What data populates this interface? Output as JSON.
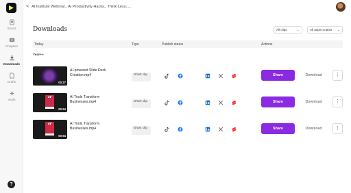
{
  "header": {
    "back_glyph": "<",
    "breadcrumb": "AI Institute Webinar_ AI Productivity Hacks_ Think Less, ..."
  },
  "sidebar": {
    "items": [
      {
        "label": "Shorts",
        "icon": "shorts-icon"
      },
      {
        "label": "Chapters",
        "icon": "chapters-icon"
      },
      {
        "label": "Downloads",
        "icon": "download-icon",
        "active": true
      },
      {
        "label": "Drafts",
        "icon": "drafts-icon"
      },
      {
        "label": "Vidds",
        "icon": "vidds-icon"
      }
    ],
    "help_glyph": "?"
  },
  "main": {
    "title": "Downloads",
    "filters": {
      "clips": "All clips",
      "aspect": "All aspect ratios"
    },
    "columns": {
      "today": "Today",
      "type": "Type",
      "publish": "Publish status",
      "actions": "Actions"
    },
    "group": "Year++",
    "rows": [
      {
        "file": "AI-powered Slide Deck Creation.mp4",
        "duration": "00:27",
        "type": "Short clip",
        "share": "Share",
        "download": "Download",
        "more": "⋮"
      },
      {
        "file": "AI Tools Transform Businesses.mp4",
        "duration": "00:54",
        "type": "Short clip",
        "share": "Share",
        "download": "Download",
        "more": "⋮"
      },
      {
        "file": "AI Tools Transform Businesses.mp4",
        "duration": "00:54",
        "type": "Short clip",
        "share": "Share",
        "download": "Download",
        "more": "⋮"
      }
    ]
  },
  "colors": {
    "accent": "#8a2be2",
    "facebook": "#1877f2",
    "linkedin": "#0a66c2",
    "youtube_shorts": "#ff2d2d"
  }
}
